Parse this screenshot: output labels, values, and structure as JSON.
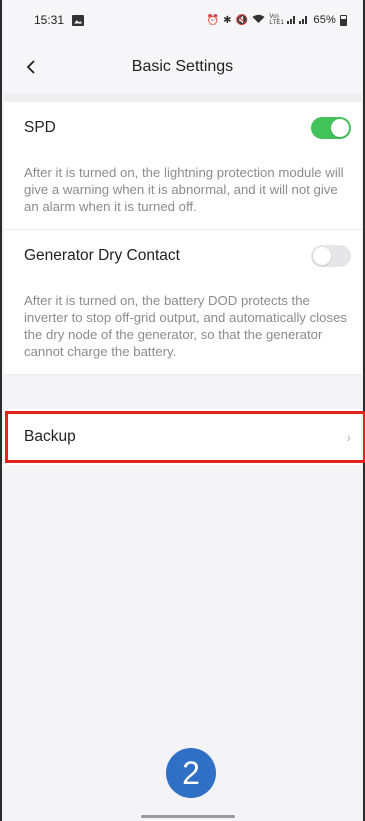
{
  "status_bar": {
    "time": "15:31",
    "signal_text": "Vo) LTE1",
    "battery_percent": "65%"
  },
  "header": {
    "title": "Basic Settings",
    "back_icon": "chevron-left-icon"
  },
  "settings": [
    {
      "label": "SPD",
      "enabled": true,
      "description": "After it is turned on, the lightning protection module will give a warning when it is abnormal, and it will not give an alarm when it is turned off."
    },
    {
      "label": "Generator Dry Contact",
      "enabled": false,
      "description": "After it is turned on, the battery DOD protects the inverter to stop off-grid output, and automatically closes the dry node of the generator, so that the generator cannot charge the battery."
    }
  ],
  "backup_row": {
    "label": "Backup",
    "chevron": "›"
  },
  "annotation": {
    "step_number": "2",
    "highlight_color": "#e2231a",
    "badge_color": "#2f6fc5"
  },
  "colors": {
    "toggle_on": "#44c25a",
    "toggle_off": "#e6e6e9"
  }
}
